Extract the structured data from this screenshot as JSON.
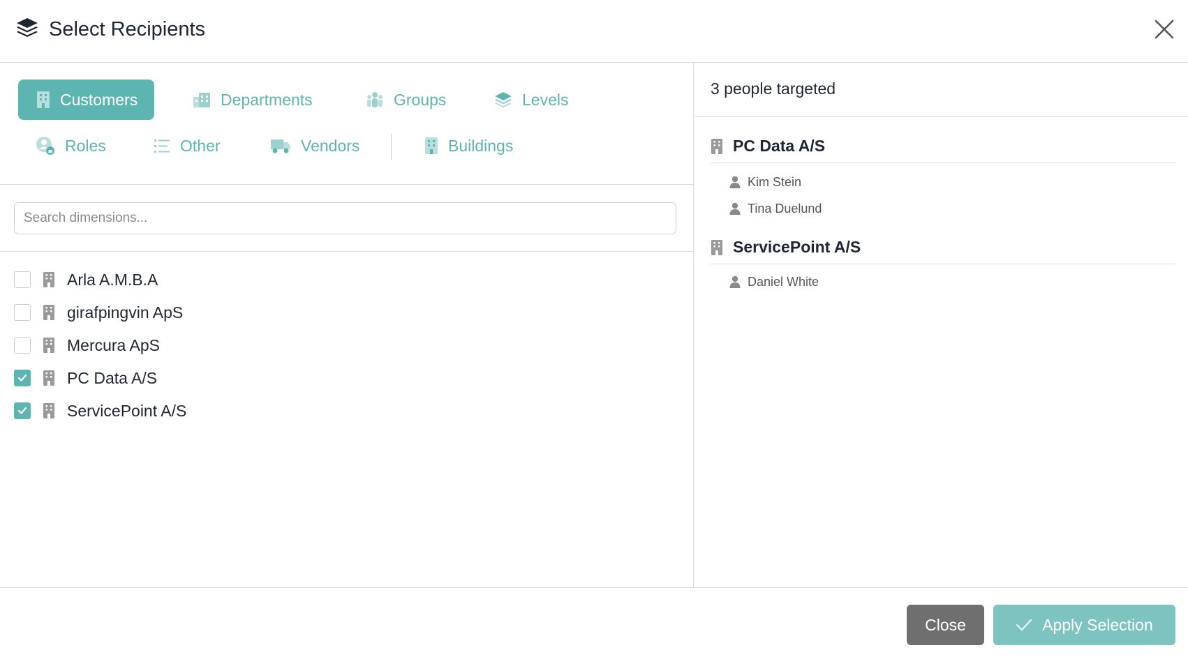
{
  "header": {
    "title": "Select Recipients",
    "logo_icon": "layers-icon",
    "close_icon": "close-icon"
  },
  "tabs": [
    {
      "label": "Customers",
      "icon": "building-icon",
      "active": true
    },
    {
      "label": "Departments",
      "icon": "office-building-icon",
      "active": false
    },
    {
      "label": "Groups",
      "icon": "people-group-icon",
      "active": false
    },
    {
      "label": "Levels",
      "icon": "layers-icon",
      "active": false
    },
    {
      "label": "Roles",
      "icon": "user-role-icon",
      "active": false
    },
    {
      "label": "Other",
      "icon": "list-icon",
      "active": false
    },
    {
      "label": "Vendors",
      "icon": "truck-icon",
      "active": false
    },
    {
      "label": "Buildings",
      "icon": "building-icon",
      "active": false
    }
  ],
  "search": {
    "placeholder": "Search dimensions...",
    "value": ""
  },
  "customers": [
    {
      "name": "Arla A.M.B.A",
      "checked": false
    },
    {
      "name": "girafpingvin ApS",
      "checked": false
    },
    {
      "name": "Mercura ApS",
      "checked": false
    },
    {
      "name": "PC Data A/S",
      "checked": true
    },
    {
      "name": "ServicePoint A/S",
      "checked": true
    }
  ],
  "summary": {
    "targeted_text": "3 people targeted",
    "groups": [
      {
        "name": "PC Data A/S",
        "people": [
          "Kim Stein",
          "Tina Duelund"
        ]
      },
      {
        "name": "ServicePoint A/S",
        "people": [
          "Daniel White"
        ]
      }
    ]
  },
  "footer": {
    "close_label": "Close",
    "apply_label": "Apply Selection"
  },
  "colors": {
    "accent": "#5db5b2",
    "apply_button": "#7dc4c1",
    "close_button": "#6f6f6f",
    "text": "#1f2533"
  }
}
